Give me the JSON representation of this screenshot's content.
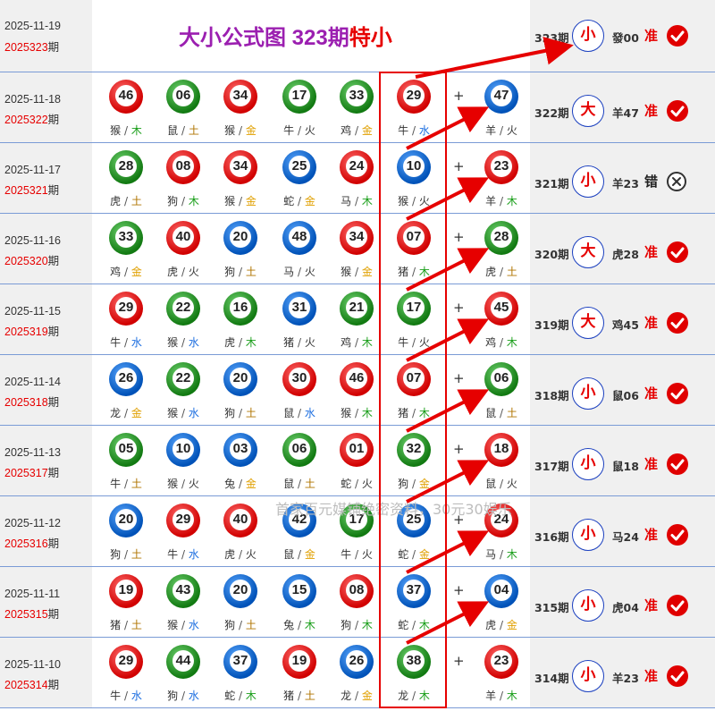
{
  "header": {
    "date": "2025-11-19",
    "period_num": "2025323",
    "period_suffix": "期",
    "title_prefix": "大小公式图",
    "title_period": "323期",
    "title_result": "特小",
    "prediction": {
      "period": "323期",
      "size": "小",
      "special": "發00",
      "result": "准",
      "status": "ok"
    }
  },
  "watermark": "首家百元媒铺绝密资料，30元30娱乐",
  "plus_sign": "+",
  "separator": "/",
  "rows": [
    {
      "date": "2025-11-18",
      "period_num": "2025322",
      "period_suffix": "期",
      "balls": [
        {
          "n": "46",
          "c": "red",
          "z": "猴",
          "e": "木"
        },
        {
          "n": "06",
          "c": "green",
          "z": "鼠",
          "e": "土"
        },
        {
          "n": "34",
          "c": "red",
          "z": "猴",
          "e": "金"
        },
        {
          "n": "17",
          "c": "green",
          "z": "牛",
          "e": "火"
        },
        {
          "n": "33",
          "c": "green",
          "z": "鸡",
          "e": "金"
        },
        {
          "n": "29",
          "c": "red",
          "z": "牛",
          "e": "水"
        },
        {
          "n": "47",
          "c": "blue",
          "z": "羊",
          "e": "火"
        }
      ],
      "prediction": {
        "period": "322期",
        "size": "大",
        "special": "羊47",
        "result": "准",
        "status": "ok"
      }
    },
    {
      "date": "2025-11-17",
      "period_num": "2025321",
      "period_suffix": "期",
      "balls": [
        {
          "n": "28",
          "c": "green",
          "z": "虎",
          "e": "土"
        },
        {
          "n": "08",
          "c": "red",
          "z": "狗",
          "e": "木"
        },
        {
          "n": "34",
          "c": "red",
          "z": "猴",
          "e": "金"
        },
        {
          "n": "25",
          "c": "blue",
          "z": "蛇",
          "e": "金"
        },
        {
          "n": "24",
          "c": "red",
          "z": "马",
          "e": "木"
        },
        {
          "n": "10",
          "c": "blue",
          "z": "猴",
          "e": "火"
        },
        {
          "n": "23",
          "c": "red",
          "z": "羊",
          "e": "木"
        }
      ],
      "prediction": {
        "period": "321期",
        "size": "小",
        "special": "羊23",
        "result": "错",
        "status": "bad"
      }
    },
    {
      "date": "2025-11-16",
      "period_num": "2025320",
      "period_suffix": "期",
      "balls": [
        {
          "n": "33",
          "c": "green",
          "z": "鸡",
          "e": "金"
        },
        {
          "n": "40",
          "c": "red",
          "z": "虎",
          "e": "火"
        },
        {
          "n": "20",
          "c": "blue",
          "z": "狗",
          "e": "土"
        },
        {
          "n": "48",
          "c": "blue",
          "z": "马",
          "e": "火"
        },
        {
          "n": "34",
          "c": "red",
          "z": "猴",
          "e": "金"
        },
        {
          "n": "07",
          "c": "red",
          "z": "猪",
          "e": "木"
        },
        {
          "n": "28",
          "c": "green",
          "z": "虎",
          "e": "土"
        }
      ],
      "prediction": {
        "period": "320期",
        "size": "大",
        "special": "虎28",
        "result": "准",
        "status": "ok"
      }
    },
    {
      "date": "2025-11-15",
      "period_num": "2025319",
      "period_suffix": "期",
      "balls": [
        {
          "n": "29",
          "c": "red",
          "z": "牛",
          "e": "水"
        },
        {
          "n": "22",
          "c": "green",
          "z": "猴",
          "e": "水"
        },
        {
          "n": "16",
          "c": "green",
          "z": "虎",
          "e": "木"
        },
        {
          "n": "31",
          "c": "blue",
          "z": "猪",
          "e": "火"
        },
        {
          "n": "21",
          "c": "green",
          "z": "鸡",
          "e": "木"
        },
        {
          "n": "17",
          "c": "green",
          "z": "牛",
          "e": "火"
        },
        {
          "n": "45",
          "c": "red",
          "z": "鸡",
          "e": "木"
        }
      ],
      "prediction": {
        "period": "319期",
        "size": "大",
        "special": "鸡45",
        "result": "准",
        "status": "ok"
      }
    },
    {
      "date": "2025-11-14",
      "period_num": "2025318",
      "period_suffix": "期",
      "balls": [
        {
          "n": "26",
          "c": "blue",
          "z": "龙",
          "e": "金"
        },
        {
          "n": "22",
          "c": "green",
          "z": "猴",
          "e": "水"
        },
        {
          "n": "20",
          "c": "blue",
          "z": "狗",
          "e": "土"
        },
        {
          "n": "30",
          "c": "red",
          "z": "鼠",
          "e": "水"
        },
        {
          "n": "46",
          "c": "red",
          "z": "猴",
          "e": "木"
        },
        {
          "n": "07",
          "c": "red",
          "z": "猪",
          "e": "木"
        },
        {
          "n": "06",
          "c": "green",
          "z": "鼠",
          "e": "土"
        }
      ],
      "prediction": {
        "period": "318期",
        "size": "小",
        "special": "鼠06",
        "result": "准",
        "status": "ok"
      }
    },
    {
      "date": "2025-11-13",
      "period_num": "2025317",
      "period_suffix": "期",
      "balls": [
        {
          "n": "05",
          "c": "green",
          "z": "牛",
          "e": "土"
        },
        {
          "n": "10",
          "c": "blue",
          "z": "猴",
          "e": "火"
        },
        {
          "n": "03",
          "c": "blue",
          "z": "兔",
          "e": "金"
        },
        {
          "n": "06",
          "c": "green",
          "z": "鼠",
          "e": "土"
        },
        {
          "n": "01",
          "c": "red",
          "z": "蛇",
          "e": "火"
        },
        {
          "n": "32",
          "c": "green",
          "z": "狗",
          "e": "金"
        },
        {
          "n": "18",
          "c": "red",
          "z": "鼠",
          "e": "火"
        }
      ],
      "prediction": {
        "period": "317期",
        "size": "小",
        "special": "鼠18",
        "result": "准",
        "status": "ok"
      }
    },
    {
      "date": "2025-11-12",
      "period_num": "2025316",
      "period_suffix": "期",
      "balls": [
        {
          "n": "20",
          "c": "blue",
          "z": "狗",
          "e": "土"
        },
        {
          "n": "29",
          "c": "red",
          "z": "牛",
          "e": "水"
        },
        {
          "n": "40",
          "c": "red",
          "z": "虎",
          "e": "火"
        },
        {
          "n": "42",
          "c": "blue",
          "z": "鼠",
          "e": "金"
        },
        {
          "n": "17",
          "c": "green",
          "z": "牛",
          "e": "火"
        },
        {
          "n": "25",
          "c": "blue",
          "z": "蛇",
          "e": "金"
        },
        {
          "n": "24",
          "c": "red",
          "z": "马",
          "e": "木"
        }
      ],
      "prediction": {
        "period": "316期",
        "size": "小",
        "special": "马24",
        "result": "准",
        "status": "ok"
      }
    },
    {
      "date": "2025-11-11",
      "period_num": "2025315",
      "period_suffix": "期",
      "balls": [
        {
          "n": "19",
          "c": "red",
          "z": "猪",
          "e": "土"
        },
        {
          "n": "43",
          "c": "green",
          "z": "猴",
          "e": "水"
        },
        {
          "n": "20",
          "c": "blue",
          "z": "狗",
          "e": "土"
        },
        {
          "n": "15",
          "c": "blue",
          "z": "兔",
          "e": "木"
        },
        {
          "n": "08",
          "c": "red",
          "z": "狗",
          "e": "木"
        },
        {
          "n": "37",
          "c": "blue",
          "z": "蛇",
          "e": "木"
        },
        {
          "n": "04",
          "c": "blue",
          "z": "虎",
          "e": "金"
        }
      ],
      "prediction": {
        "period": "315期",
        "size": "小",
        "special": "虎04",
        "result": "准",
        "status": "ok"
      }
    },
    {
      "date": "2025-11-10",
      "period_num": "2025314",
      "period_suffix": "期",
      "balls": [
        {
          "n": "29",
          "c": "red",
          "z": "牛",
          "e": "水"
        },
        {
          "n": "44",
          "c": "green",
          "z": "狗",
          "e": "水"
        },
        {
          "n": "37",
          "c": "blue",
          "z": "蛇",
          "e": "木"
        },
        {
          "n": "19",
          "c": "red",
          "z": "猪",
          "e": "土"
        },
        {
          "n": "26",
          "c": "blue",
          "z": "龙",
          "e": "金"
        },
        {
          "n": "38",
          "c": "green",
          "z": "龙",
          "e": "木"
        },
        {
          "n": "23",
          "c": "red",
          "z": "羊",
          "e": "木"
        }
      ],
      "prediction": {
        "period": "314期",
        "size": "小",
        "special": "羊23",
        "result": "准",
        "status": "ok"
      }
    }
  ]
}
